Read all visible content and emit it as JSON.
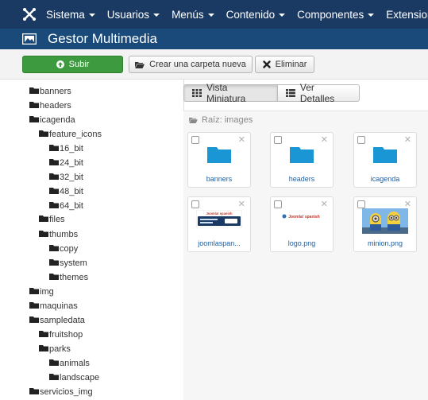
{
  "topnav": {
    "items": [
      "Sistema",
      "Usuarios",
      "Menús",
      "Contenido",
      "Componentes",
      "Extensiones"
    ]
  },
  "header": {
    "title": "Gestor Multimedia"
  },
  "toolbar": {
    "upload": "Subir",
    "new_folder": "Crear una carpeta nueva",
    "delete": "Eliminar"
  },
  "tree": {
    "items": [
      "banners",
      "headers",
      "icagenda",
      "feature_icons",
      "16_bit",
      "24_bit",
      "32_bit",
      "48_bit",
      "64_bit",
      "files",
      "thumbs",
      "copy",
      "system",
      "themes",
      "img",
      "maquinas",
      "sampledata",
      "fruitshop",
      "parks",
      "animals",
      "landscape",
      "servicios_img"
    ]
  },
  "view": {
    "thumbnails": "Vista Miniatura",
    "details": "Ver Detalles"
  },
  "breadcrumb": "Raíz: images",
  "thumbs": [
    {
      "name": "banners",
      "kind": "folder"
    },
    {
      "name": "headers",
      "kind": "folder"
    },
    {
      "name": "icagenda",
      "kind": "folder"
    },
    {
      "name": "joomlaspan...",
      "kind": "image",
      "preview_text": "Joomla! spanish"
    },
    {
      "name": "logo.png",
      "kind": "image",
      "preview_text": "Joomla! spanish"
    },
    {
      "name": "minion.png",
      "kind": "image"
    }
  ],
  "colors": {
    "nav": "#1b3a63",
    "header": "#1a4a7a",
    "folder": "#1a96d4",
    "upload": "#3e9a3e",
    "link": "#1a5fa8"
  }
}
